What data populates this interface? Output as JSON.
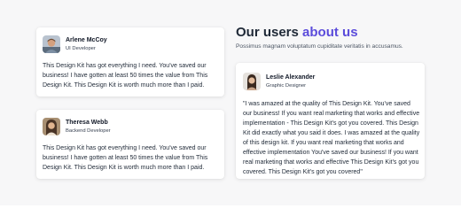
{
  "heading": {
    "prefix": "Our users",
    "accent": "about us"
  },
  "subtitle": "Possimus magnam voluptatum cupiditate veritatis in accusamus.",
  "testimonials": [
    {
      "name": "Arlene McCoy",
      "role": "UI Developer",
      "text": "This Design Kit has got everything I need. You've saved our business! I have gotten at least 50 times the value from This Design Kit. This Design Kit is worth much more than I paid."
    },
    {
      "name": "Theresa Webb",
      "role": "Backend Developer",
      "text": "This Design Kit has got everything I need. You've saved our business! I have gotten at least 50 times the value from This Design Kit. This Design Kit is worth much more than I paid."
    },
    {
      "name": "Leslie Alexander",
      "role": "Graphic Designer",
      "text": "\"I was amazed at the quality of This Design Kit. You've saved our business! If you want real marketing that works and effective implementation - This Design Kit's got you covered. This Design Kit did exactly what you said it does. I was amazed at the quality of this design kit. If you want real marketing that works and effective implementation You've saved our business! If you want real marketing that works and effective This Design Kit's got you covered. This Design Kit's got you covered\""
    }
  ],
  "colors": {
    "accent": "#5b4cdb",
    "section_background": "#f7f7f8",
    "card_background": "#ffffff"
  }
}
